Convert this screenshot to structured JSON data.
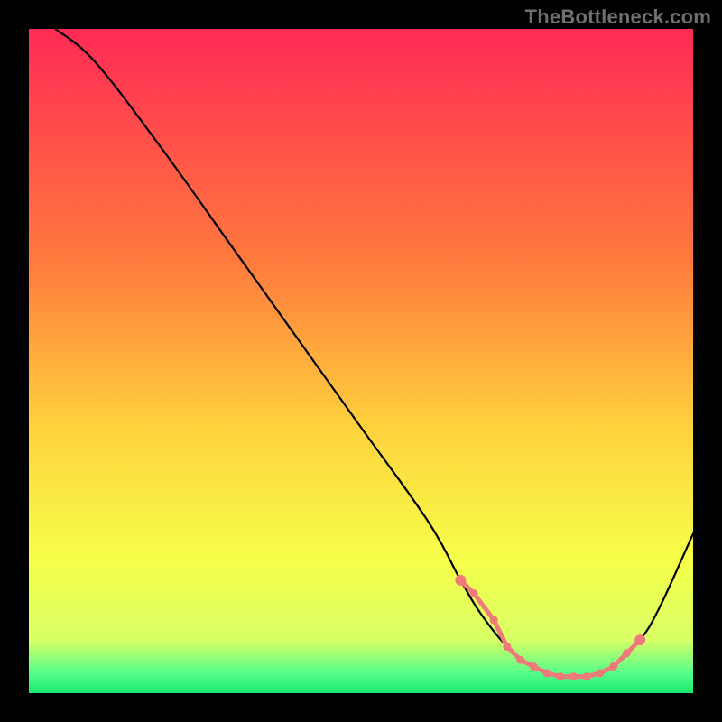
{
  "watermark": "TheBottleneck.com",
  "chart_data": {
    "type": "line",
    "title": "",
    "xlabel": "",
    "ylabel": "",
    "xlim": [
      0,
      100
    ],
    "ylim": [
      0,
      100
    ],
    "grid": false,
    "series": [
      {
        "name": "curve",
        "color": "#000000",
        "x": [
          4,
          10,
          20,
          30,
          40,
          50,
          60,
          65,
          68,
          72,
          76,
          80,
          84,
          88,
          92,
          95,
          100
        ],
        "y": [
          100,
          95,
          82,
          68,
          54,
          40,
          26,
          17,
          12,
          7,
          4,
          2.5,
          2.5,
          4,
          8,
          13,
          24
        ]
      },
      {
        "name": "markers",
        "type": "scatter",
        "color": "#ef7a7a",
        "x": [
          65,
          67,
          70,
          72,
          74,
          76,
          78,
          80,
          82,
          84,
          86,
          88,
          90,
          92
        ],
        "y": [
          17,
          15,
          11,
          7,
          5,
          4,
          3,
          2.5,
          2.5,
          2.5,
          3,
          4,
          6,
          8
        ]
      }
    ],
    "background_gradient": {
      "stops": [
        {
          "offset": 0.0,
          "color": "#ff2a55"
        },
        {
          "offset": 0.35,
          "color": "#ff7a3d"
        },
        {
          "offset": 0.6,
          "color": "#ffd23d"
        },
        {
          "offset": 0.8,
          "color": "#f6ff4a"
        },
        {
          "offset": 0.92,
          "color": "#d8ff66"
        },
        {
          "offset": 0.97,
          "color": "#56ff8a"
        },
        {
          "offset": 1.0,
          "color": "#19e86f"
        }
      ]
    }
  }
}
